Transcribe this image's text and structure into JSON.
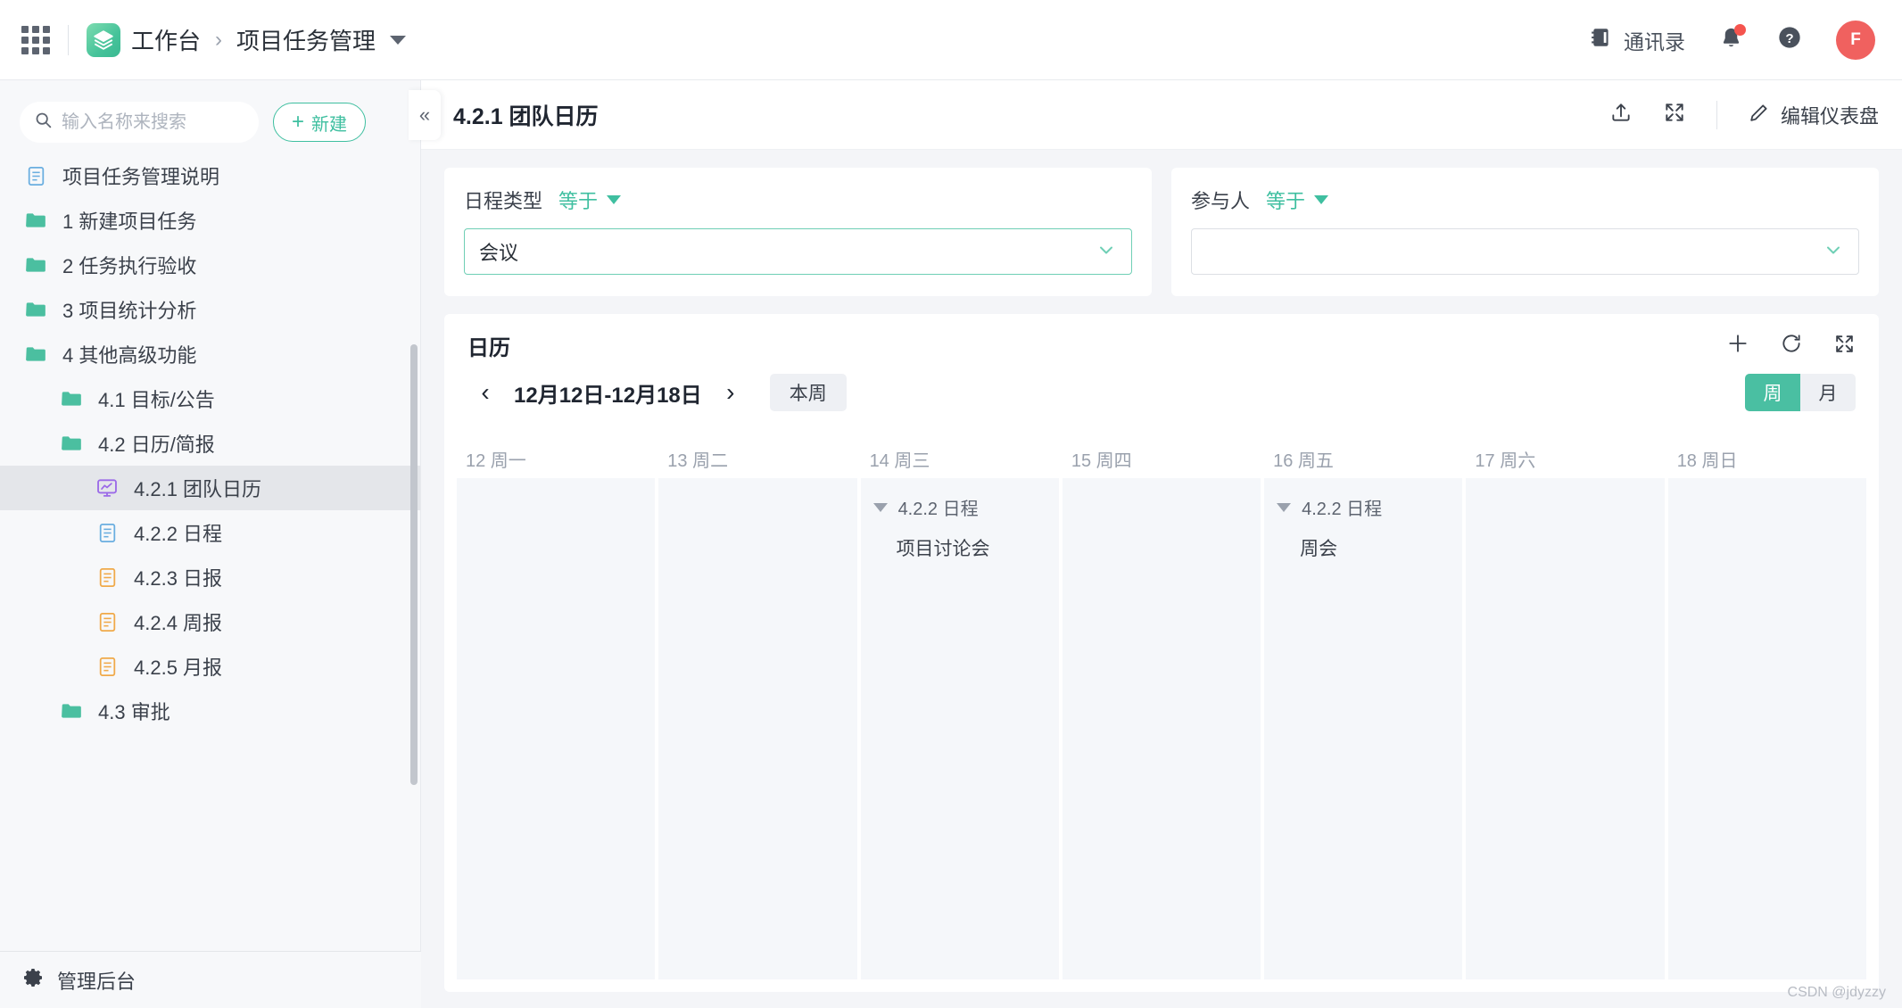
{
  "topbar": {
    "apps_icon": "grid-apps-icon",
    "logo_icon": "workspace-logo-icon",
    "workspace": "工作台",
    "breadcrumb_sep": "›",
    "project": "项目任务管理",
    "contacts_label": "通讯录",
    "contacts_icon": "address-book-icon",
    "bell_icon": "bell-icon",
    "help_icon": "question-circle-icon",
    "avatar_initial": "F"
  },
  "sidebar": {
    "search": {
      "placeholder": "输入名称来搜索",
      "value": "",
      "icon": "search-icon"
    },
    "new_button": {
      "label": "新建",
      "plus": "+"
    },
    "items": [
      {
        "label": "项目任务管理说明",
        "icon": "doc-blue-icon",
        "level": 0,
        "selected": false
      },
      {
        "label": "1 新建项目任务",
        "icon": "folder-green-icon",
        "level": 0,
        "selected": false
      },
      {
        "label": "2 任务执行验收",
        "icon": "folder-green-icon",
        "level": 0,
        "selected": false
      },
      {
        "label": "3 项目统计分析",
        "icon": "folder-green-icon",
        "level": 0,
        "selected": false
      },
      {
        "label": "4 其他高级功能",
        "icon": "folder-green-icon",
        "level": 0,
        "selected": false
      },
      {
        "label": "4.1 目标/公告",
        "icon": "folder-green-icon",
        "level": 1,
        "selected": false
      },
      {
        "label": "4.2 日历/简报",
        "icon": "folder-green-icon",
        "level": 1,
        "selected": false
      },
      {
        "label": "4.2.1 团队日历",
        "icon": "dashboard-purple-icon",
        "level": 2,
        "selected": true
      },
      {
        "label": "4.2.2 日程",
        "icon": "doc-blue-icon",
        "level": 2,
        "selected": false
      },
      {
        "label": "4.2.3 日报",
        "icon": "doc-orange-icon",
        "level": 2,
        "selected": false
      },
      {
        "label": "4.2.4 周报",
        "icon": "doc-orange-icon",
        "level": 2,
        "selected": false
      },
      {
        "label": "4.2.5 月报",
        "icon": "doc-orange-icon",
        "level": 2,
        "selected": false
      },
      {
        "label": "4.3 审批",
        "icon": "folder-green-icon",
        "level": 1,
        "selected": false
      }
    ],
    "footer": {
      "label": "管理后台",
      "icon": "gear-icon"
    }
  },
  "content": {
    "collapse_icon": "double-chevron-left-icon",
    "page_title": "4.2.1 团队日历",
    "share_icon": "upload-share-icon",
    "fullscreen_icon": "fullscreen-icon",
    "edit_dashboard_label": "编辑仪表盘",
    "edit_icon": "pencil-icon"
  },
  "filters": [
    {
      "label": "日程类型",
      "operator": "等于",
      "value": "会议",
      "placeholder": "",
      "focused": true,
      "chevron_icon": "chevron-down-icon"
    },
    {
      "label": "参与人",
      "operator": "等于",
      "value": "",
      "placeholder": "",
      "focused": false,
      "chevron_icon": "chevron-down-icon"
    }
  ],
  "calendar": {
    "card_title": "日历",
    "card_icons": [
      "plus-icon",
      "refresh-icon",
      "fullscreen-icon"
    ],
    "prev_icon": "chevron-left-icon",
    "next_icon": "chevron-right-icon",
    "week_range": "12月12日-12月18日",
    "this_week_label": "本周",
    "view_modes": [
      {
        "label": "周",
        "active": true
      },
      {
        "label": "月",
        "active": false
      }
    ],
    "columns": [
      {
        "header": "12 周一",
        "events": []
      },
      {
        "header": "13 周二",
        "events": []
      },
      {
        "header": "14 周三",
        "events": [
          {
            "group": "4.2.2 日程",
            "items": [
              "项目讨论会"
            ]
          }
        ]
      },
      {
        "header": "15 周四",
        "events": []
      },
      {
        "header": "16 周五",
        "events": [
          {
            "group": "4.2.2 日程",
            "items": [
              "周会"
            ]
          }
        ]
      },
      {
        "header": "17 周六",
        "events": []
      },
      {
        "header": "18 周日",
        "events": []
      }
    ]
  },
  "watermark": "CSDN @jdyzzy",
  "colors": {
    "accent_green": "#3fbfa0",
    "toggle_green": "#4abfa2",
    "avatar_red": "#f0615f",
    "badge_red": "#f5544e",
    "sidebar_bg": "#f7f8fa",
    "content_bg": "#f4f5f8",
    "column_bg": "#f5f7fa"
  }
}
